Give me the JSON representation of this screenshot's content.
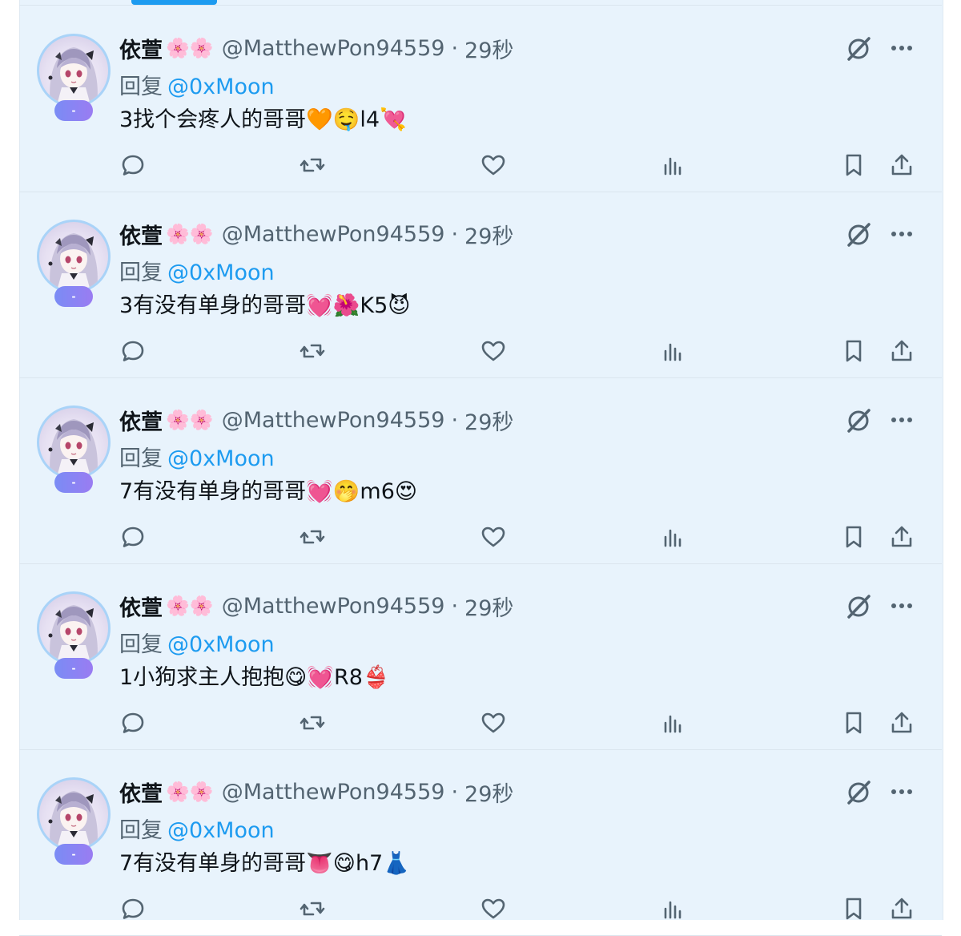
{
  "feed": {
    "tweets": [
      {
        "name": "依萱",
        "flowers": "🌸🌸",
        "handle": "@MatthewPon94559",
        "separator": "·",
        "time": "29秒",
        "reply_prefix": "回复",
        "reply_to": "@0xMoon",
        "text": "3找个会疼人的哥哥🧡🤤l4💘",
        "badge": "-"
      },
      {
        "name": "依萱",
        "flowers": "🌸🌸",
        "handle": "@MatthewPon94559",
        "separator": "·",
        "time": "29秒",
        "reply_prefix": "回复",
        "reply_to": "@0xMoon",
        "text": "3有没有单身的哥哥💓🌺K5😈",
        "badge": "-"
      },
      {
        "name": "依萱",
        "flowers": "🌸🌸",
        "handle": "@MatthewPon94559",
        "separator": "·",
        "time": "29秒",
        "reply_prefix": "回复",
        "reply_to": "@0xMoon",
        "text": "7有没有单身的哥哥💓🤭m6😍",
        "badge": "-"
      },
      {
        "name": "依萱",
        "flowers": "🌸🌸",
        "handle": "@MatthewPon94559",
        "separator": "·",
        "time": "29秒",
        "reply_prefix": "回复",
        "reply_to": "@0xMoon",
        "text": "1小狗求主人抱抱😋💓R8👙",
        "badge": "-"
      },
      {
        "name": "依萱",
        "flowers": "🌸🌸",
        "handle": "@MatthewPon94559",
        "separator": "·",
        "time": "29秒",
        "reply_prefix": "回复",
        "reply_to": "@0xMoon",
        "text": "7有没有单身的哥哥👅😋h7👗",
        "badge": "-"
      }
    ]
  },
  "icons": {
    "grok": "grok-icon",
    "more": "more-icon",
    "reply": "reply-icon",
    "retweet": "retweet-icon",
    "like": "like-icon",
    "views": "views-icon",
    "bookmark": "bookmark-icon",
    "share": "share-icon"
  },
  "colors": {
    "accent": "#1d9bf0",
    "feed_bg": "#e8f3fc",
    "muted_text": "#536471",
    "primary_text": "#0f1419",
    "badge_gradient_start": "#7a8cf5",
    "badge_gradient_end": "#9a7cf2"
  }
}
